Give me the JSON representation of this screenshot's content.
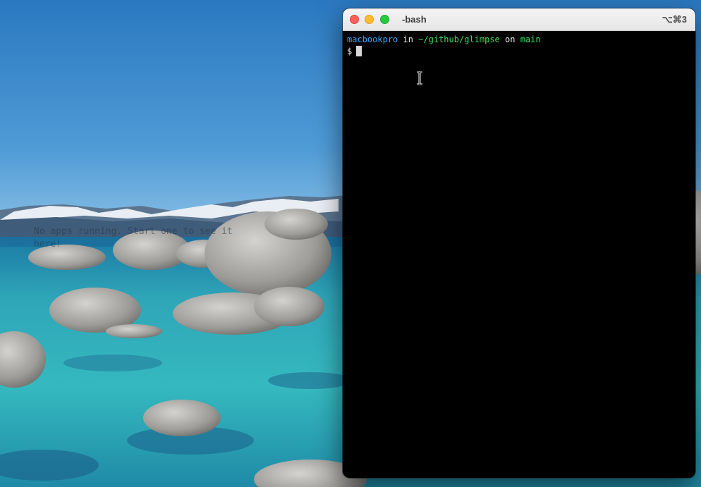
{
  "desktop": {
    "overlay_line1": "No apps running. Start one to see it",
    "overlay_line2": "here!"
  },
  "terminal": {
    "title": "-bash",
    "shortcut": "⌥⌘3",
    "prompt": {
      "host": "macbookpro",
      "in_word": "in",
      "path": "~/github/glimpse",
      "on_word": "on",
      "branch": "main",
      "symbol": "$"
    }
  },
  "colors": {
    "host": "#3aa6ff",
    "path_branch": "#3fe05a",
    "close": "#fe5f57",
    "minimize": "#febc2e",
    "maximize": "#28c840"
  },
  "icons": [
    "close-button",
    "minimize-button",
    "maximize-button",
    "text-cursor-icon"
  ]
}
